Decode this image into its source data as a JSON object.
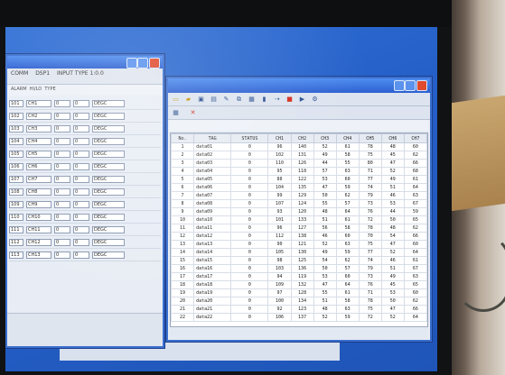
{
  "back_window": {
    "title": "",
    "toolbar": [
      "COMM",
      "DSP1",
      "INPUT TYPE 1:0.0"
    ],
    "header": [
      "ALARM",
      "HI/LO",
      "TYPE"
    ],
    "rows": [
      {
        "id": "101",
        "name": "CH1",
        "lo": "0",
        "hi": "0",
        "unit": "DEGC"
      },
      {
        "id": "102",
        "name": "CH2",
        "lo": "0",
        "hi": "0",
        "unit": "DEGC"
      },
      {
        "id": "103",
        "name": "CH3",
        "lo": "0",
        "hi": "0",
        "unit": "DEGC"
      },
      {
        "id": "104",
        "name": "CH4",
        "lo": "0",
        "hi": "0",
        "unit": "DEGC"
      },
      {
        "id": "105",
        "name": "CH5",
        "lo": "0",
        "hi": "0",
        "unit": "DEGC"
      },
      {
        "id": "106",
        "name": "CH6",
        "lo": "0",
        "hi": "0",
        "unit": "DEGC"
      },
      {
        "id": "107",
        "name": "CH7",
        "lo": "0",
        "hi": "0",
        "unit": "DEGC"
      },
      {
        "id": "108",
        "name": "CH8",
        "lo": "0",
        "hi": "0",
        "unit": "DEGC"
      },
      {
        "id": "109",
        "name": "CH9",
        "lo": "0",
        "hi": "0",
        "unit": "DEGC"
      },
      {
        "id": "110",
        "name": "CH10",
        "lo": "0",
        "hi": "0",
        "unit": "DEGC"
      },
      {
        "id": "111",
        "name": "CH11",
        "lo": "0",
        "hi": "0",
        "unit": "DEGC"
      },
      {
        "id": "112",
        "name": "CH12",
        "lo": "0",
        "hi": "0",
        "unit": "DEGC"
      },
      {
        "id": "113",
        "name": "CH13",
        "lo": "0",
        "hi": "0",
        "unit": "DEGC"
      }
    ],
    "footer_left": "",
    "footer_right": "",
    "footer_bottom": ""
  },
  "front_window": {
    "title": "",
    "toolbar2_label": "",
    "path": "",
    "columns": [
      "No.",
      "TAG",
      "STATUS",
      "CH1",
      "CH2",
      "CH3",
      "CH4",
      "CH5",
      "CH6",
      "CH7"
    ],
    "rows": [
      [
        "1",
        "data01",
        "0",
        "96",
        "140",
        "52",
        "61",
        "78",
        "48",
        "60"
      ],
      [
        "2",
        "data02",
        "0",
        "102",
        "131",
        "49",
        "58",
        "75",
        "45",
        "62"
      ],
      [
        "3",
        "data03",
        "0",
        "110",
        "126",
        "44",
        "55",
        "80",
        "47",
        "66"
      ],
      [
        "4",
        "data04",
        "0",
        "95",
        "118",
        "57",
        "63",
        "71",
        "52",
        "68"
      ],
      [
        "5",
        "data05",
        "0",
        "88",
        "122",
        "53",
        "60",
        "77",
        "49",
        "61"
      ],
      [
        "6",
        "data06",
        "0",
        "104",
        "135",
        "47",
        "59",
        "74",
        "51",
        "64"
      ],
      [
        "7",
        "data07",
        "0",
        "99",
        "129",
        "50",
        "62",
        "79",
        "46",
        "63"
      ],
      [
        "8",
        "data08",
        "0",
        "107",
        "124",
        "55",
        "57",
        "73",
        "53",
        "67"
      ],
      [
        "9",
        "data09",
        "0",
        "93",
        "120",
        "48",
        "64",
        "76",
        "44",
        "59"
      ],
      [
        "10",
        "data10",
        "0",
        "101",
        "133",
        "51",
        "61",
        "72",
        "50",
        "65"
      ],
      [
        "11",
        "data11",
        "0",
        "96",
        "127",
        "56",
        "58",
        "78",
        "48",
        "62"
      ],
      [
        "12",
        "data12",
        "0",
        "112",
        "138",
        "46",
        "60",
        "70",
        "54",
        "66"
      ],
      [
        "13",
        "data13",
        "0",
        "90",
        "121",
        "52",
        "63",
        "75",
        "47",
        "60"
      ],
      [
        "14",
        "data14",
        "0",
        "105",
        "130",
        "49",
        "59",
        "77",
        "52",
        "64"
      ],
      [
        "15",
        "data15",
        "0",
        "98",
        "125",
        "54",
        "62",
        "74",
        "46",
        "61"
      ],
      [
        "16",
        "data16",
        "0",
        "103",
        "136",
        "50",
        "57",
        "79",
        "51",
        "67"
      ],
      [
        "17",
        "data17",
        "0",
        "94",
        "119",
        "53",
        "60",
        "73",
        "49",
        "63"
      ],
      [
        "18",
        "data18",
        "0",
        "109",
        "132",
        "47",
        "64",
        "76",
        "45",
        "65"
      ],
      [
        "19",
        "data19",
        "0",
        "97",
        "128",
        "55",
        "61",
        "71",
        "53",
        "60"
      ],
      [
        "20",
        "data20",
        "0",
        "100",
        "134",
        "51",
        "58",
        "78",
        "50",
        "62"
      ],
      [
        "21",
        "data21",
        "0",
        "92",
        "123",
        "48",
        "63",
        "75",
        "47",
        "66"
      ],
      [
        "22",
        "data22",
        "0",
        "106",
        "137",
        "52",
        "59",
        "72",
        "52",
        "64"
      ]
    ],
    "status": ""
  }
}
